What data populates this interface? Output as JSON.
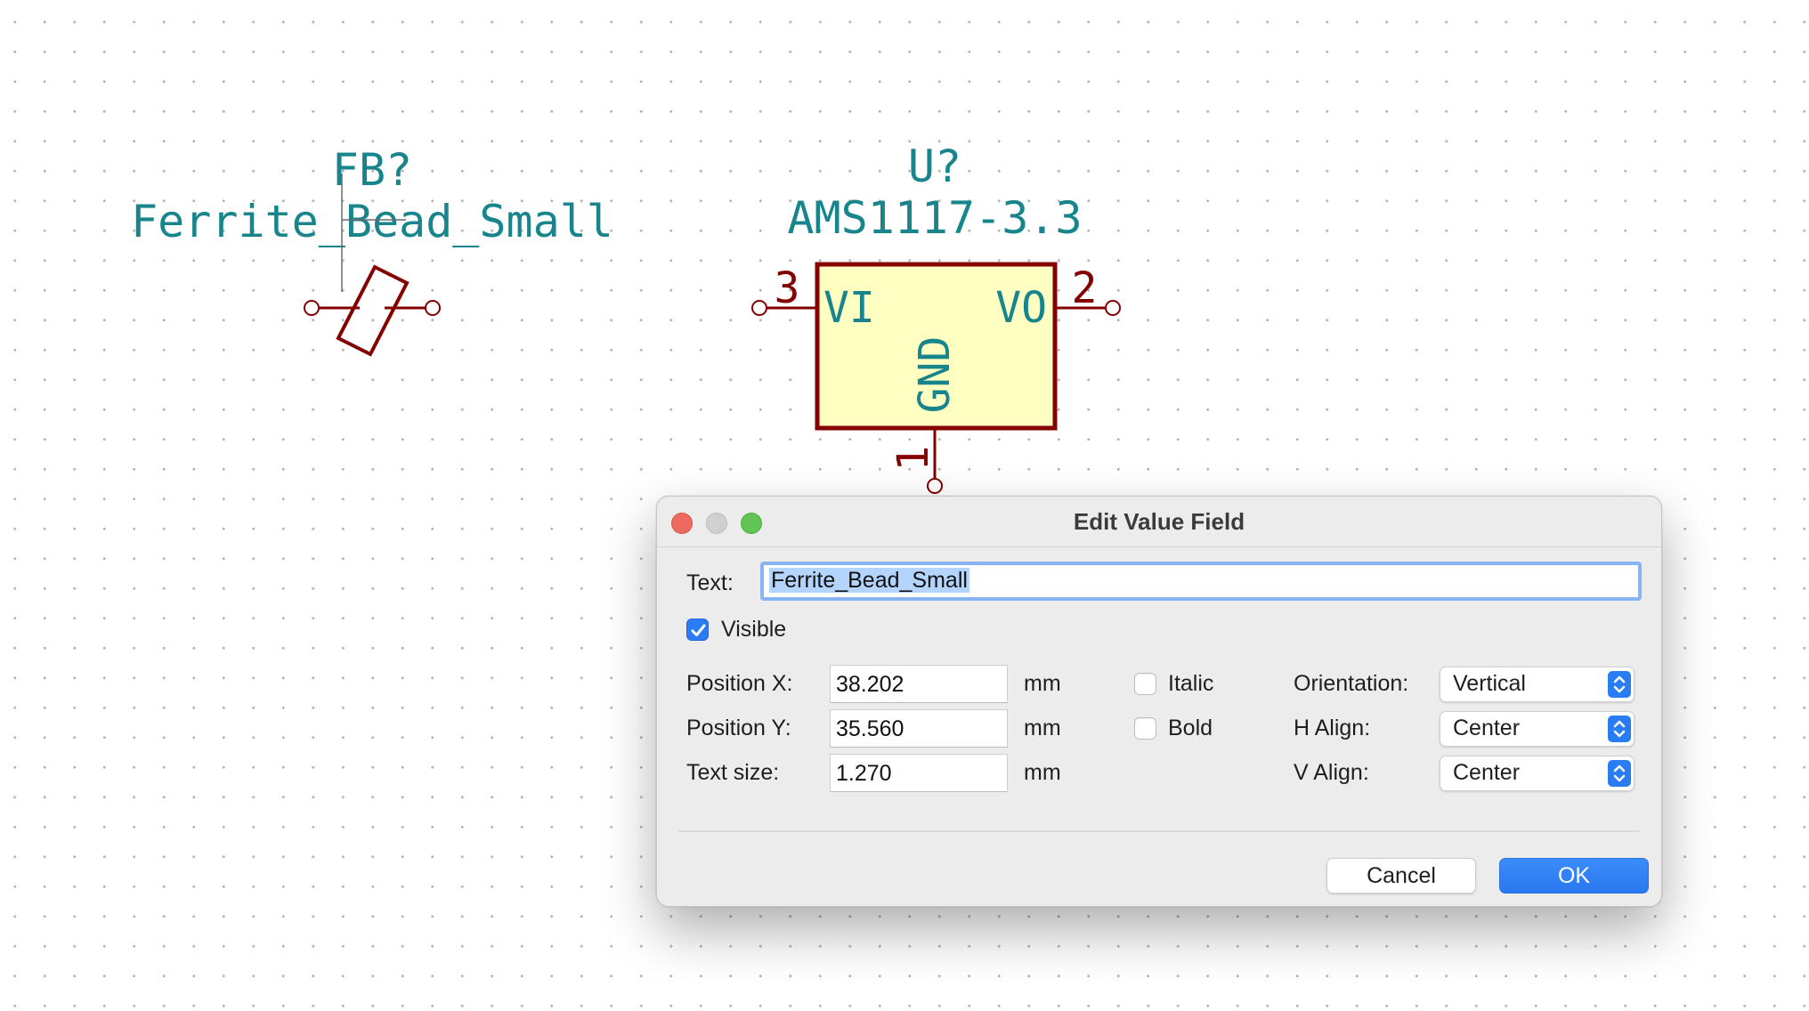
{
  "schematic": {
    "ferrite": {
      "reference": "FB?",
      "value": "Ferrite_Bead_Small"
    },
    "regulator": {
      "reference": "U?",
      "value": "AMS1117-3.3",
      "pins": {
        "vi_label": "VI",
        "vo_label": "VO",
        "gnd_label": "GND",
        "vi_number": "3",
        "vo_number": "2",
        "gnd_number": "1"
      }
    },
    "colors": {
      "text": "#17858b",
      "symbol_outline": "#840000",
      "symbol_fill": "#ffffc2"
    }
  },
  "dialog": {
    "title": "Edit Value Field",
    "text_label": "Text:",
    "text_value": "Ferrite_Bead_Small",
    "visible_label": "Visible",
    "visible_checked": true,
    "position_x_label": "Position X:",
    "position_x_value": "38.202",
    "position_y_label": "Position Y:",
    "position_y_value": "35.560",
    "text_size_label": "Text size:",
    "text_size_value": "1.270",
    "unit": "mm",
    "italic_label": "Italic",
    "italic_checked": false,
    "bold_label": "Bold",
    "bold_checked": false,
    "orientation_label": "Orientation:",
    "orientation_value": "Vertical",
    "h_align_label": "H Align:",
    "h_align_value": "Center",
    "v_align_label": "V Align:",
    "v_align_value": "Center",
    "cancel_label": "Cancel",
    "ok_label": "OK",
    "accent_color": "#2a7cf5"
  }
}
